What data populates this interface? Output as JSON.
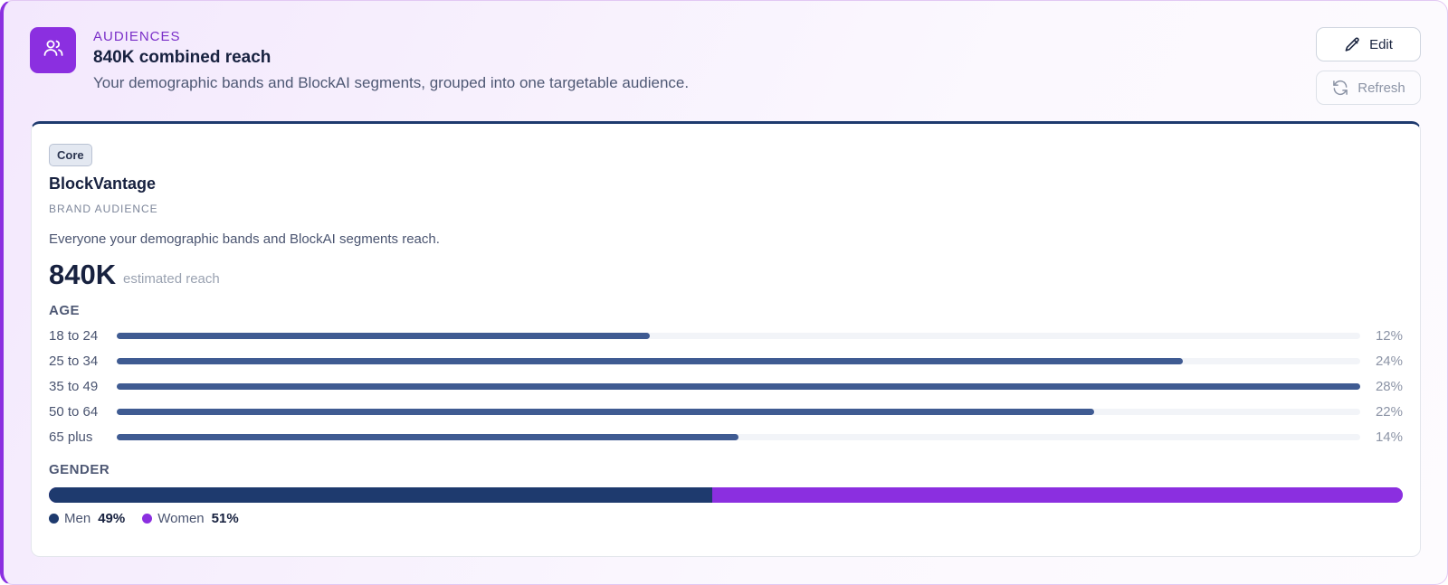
{
  "header": {
    "eyebrow": "AUDIENCES",
    "title": "840K combined reach",
    "subtitle": "Your demographic bands and BlockAI segments, grouped into one targetable audience.",
    "icon": "users-icon",
    "accent_color": "#8b2fe0"
  },
  "actions": {
    "edit_label": "Edit",
    "edit_icon": "pencil-icon",
    "refresh_label": "Refresh",
    "refresh_icon": "refresh-icon"
  },
  "card": {
    "chip": "Core",
    "title": "BlockVantage",
    "eyebrow": "BRAND AUDIENCE",
    "description": "Everyone your demographic bands and BlockAI segments reach.",
    "reach_value": "840K",
    "reach_label": "estimated reach",
    "accent_color": "#1e3a6e"
  },
  "age": {
    "section_label": "AGE",
    "bar_color": "#3f5b92",
    "rows": [
      {
        "label": "18 to 24",
        "pct": "12%",
        "fill_fraction": 0.429
      },
      {
        "label": "25 to 34",
        "pct": "24%",
        "fill_fraction": 0.857
      },
      {
        "label": "35 to 49",
        "pct": "28%",
        "fill_fraction": 1.0
      },
      {
        "label": "50 to 64",
        "pct": "22%",
        "fill_fraction": 0.786
      },
      {
        "label": "65 plus",
        "pct": "14%",
        "fill_fraction": 0.5
      }
    ]
  },
  "gender": {
    "section_label": "GENDER",
    "men": {
      "label": "Men",
      "pct": "49%",
      "fraction": 0.49,
      "color": "#1e3a6e"
    },
    "women": {
      "label": "Women",
      "pct": "51%",
      "fraction": 0.51,
      "color": "#8b2fe0"
    }
  }
}
